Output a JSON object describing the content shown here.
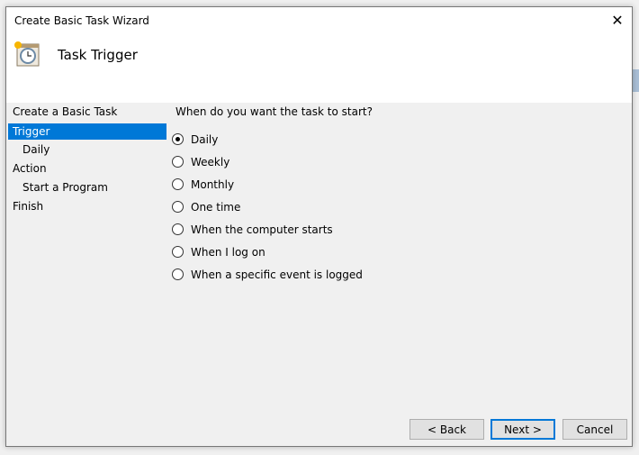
{
  "window": {
    "title": "Create Basic Task Wizard",
    "close_icon": "close-icon"
  },
  "header": {
    "title": "Task Trigger",
    "icon": "task-clock-icon"
  },
  "nav": {
    "items": [
      {
        "label": "Create a Basic Task",
        "sub": false,
        "selected": false
      },
      {
        "label": "Trigger",
        "sub": false,
        "selected": true
      },
      {
        "label": "Daily",
        "sub": true,
        "selected": false
      },
      {
        "label": "Action",
        "sub": false,
        "selected": false
      },
      {
        "label": "Start a Program",
        "sub": true,
        "selected": false
      },
      {
        "label": "Finish",
        "sub": false,
        "selected": false
      }
    ]
  },
  "main": {
    "question": "When do you want the task to start?",
    "options": [
      {
        "label": "Daily",
        "checked": true
      },
      {
        "label": "Weekly",
        "checked": false
      },
      {
        "label": "Monthly",
        "checked": false
      },
      {
        "label": "One time",
        "checked": false
      },
      {
        "label": "When the computer starts",
        "checked": false
      },
      {
        "label": "When I log on",
        "checked": false
      },
      {
        "label": "When a specific event is logged",
        "checked": false
      }
    ]
  },
  "buttons": {
    "back": "< Back",
    "next": "Next >",
    "cancel": "Cancel"
  },
  "colors": {
    "accent": "#0078d7"
  }
}
